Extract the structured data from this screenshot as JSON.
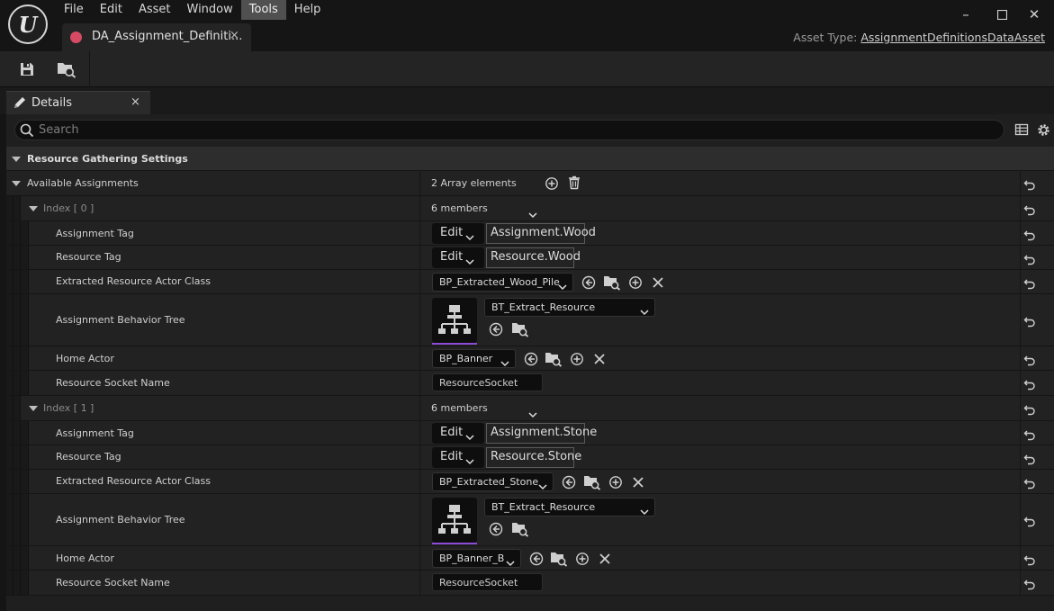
{
  "menu": [
    "File",
    "Edit",
    "Asset",
    "Window",
    "Tools",
    "Help"
  ],
  "menu_active": "Tools",
  "window_controls": {
    "minimize": "–",
    "maximize": "☐",
    "close": "✕"
  },
  "document_tab": {
    "label": "DA_Assignment_Definiti...",
    "close": "×",
    "icon": "data-asset-icon",
    "icon_color": "#d64a63"
  },
  "asset_type": {
    "label": "Asset Type:",
    "value": "AssignmentDefinitionsDataAsset"
  },
  "toolbar": {
    "save_icon": "save-icon",
    "browse_icon": "browse-to-asset-icon"
  },
  "details_tab": {
    "label": "Details",
    "close": "×"
  },
  "search": {
    "placeholder": "Search"
  },
  "category": {
    "label": "Resource Gathering Settings"
  },
  "available": {
    "label": "Available Assignments",
    "value": "2 Array elements"
  },
  "entries": [
    {
      "index_label": "Index [ 0 ]",
      "members": "6 members",
      "assignment_tag": {
        "label": "Assignment Tag",
        "edit": "Edit",
        "value": "Assignment.Wood"
      },
      "resource_tag": {
        "label": "Resource Tag",
        "edit": "Edit",
        "value": "Resource.Wood"
      },
      "extracted_class": {
        "label": "Extracted Resource Actor Class",
        "value": "BP_Extracted_Wood_Pile"
      },
      "behavior_tree": {
        "label": "Assignment Behavior Tree",
        "value": "BT_Extract_Resource"
      },
      "home_actor": {
        "label": "Home Actor",
        "value": "BP_Banner"
      },
      "socket": {
        "label": "Resource Socket Name",
        "value": "ResourceSocket"
      }
    },
    {
      "index_label": "Index [ 1 ]",
      "members": "6 members",
      "assignment_tag": {
        "label": "Assignment Tag",
        "edit": "Edit",
        "value": "Assignment.Stone"
      },
      "resource_tag": {
        "label": "Resource Tag",
        "edit": "Edit",
        "value": "Resource.Stone"
      },
      "extracted_class": {
        "label": "Extracted Resource Actor Class",
        "value": "BP_Extracted_Stone"
      },
      "behavior_tree": {
        "label": "Assignment Behavior Tree",
        "value": "BT_Extract_Resource"
      },
      "home_actor": {
        "label": "Home Actor",
        "value": "BP_Banner_B"
      },
      "socket": {
        "label": "Resource Socket Name",
        "value": "ResourceSocket"
      }
    }
  ],
  "colors": {
    "accent_purple": "#8c4bd8",
    "active_menu": "#505050"
  }
}
